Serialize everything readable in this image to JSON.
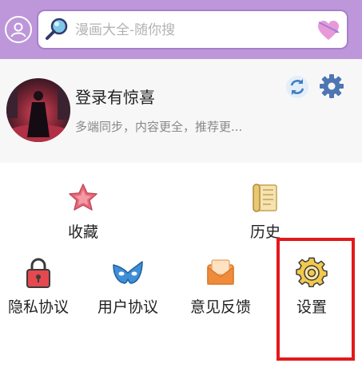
{
  "search": {
    "placeholder": "漫画大全-随你搜"
  },
  "profile": {
    "title": "登录有惊喜",
    "subtitle": "多端同步，内容更全，推荐更..."
  },
  "menu_row1": [
    {
      "label": "收藏",
      "icon": "star-icon"
    },
    {
      "label": "历史",
      "icon": "scroll-icon"
    }
  ],
  "menu_row2": [
    {
      "label": "隐私协议",
      "icon": "lock-icon"
    },
    {
      "label": "用户协议",
      "icon": "mask-icon"
    },
    {
      "label": "意见反馈",
      "icon": "envelope-icon"
    },
    {
      "label": "设置",
      "icon": "settings-gear-icon"
    }
  ],
  "colors": {
    "header": "#bd97da",
    "search_border": "#a77fcb",
    "highlight": "#e2191b",
    "profile_bg": "#f7f7f7"
  }
}
